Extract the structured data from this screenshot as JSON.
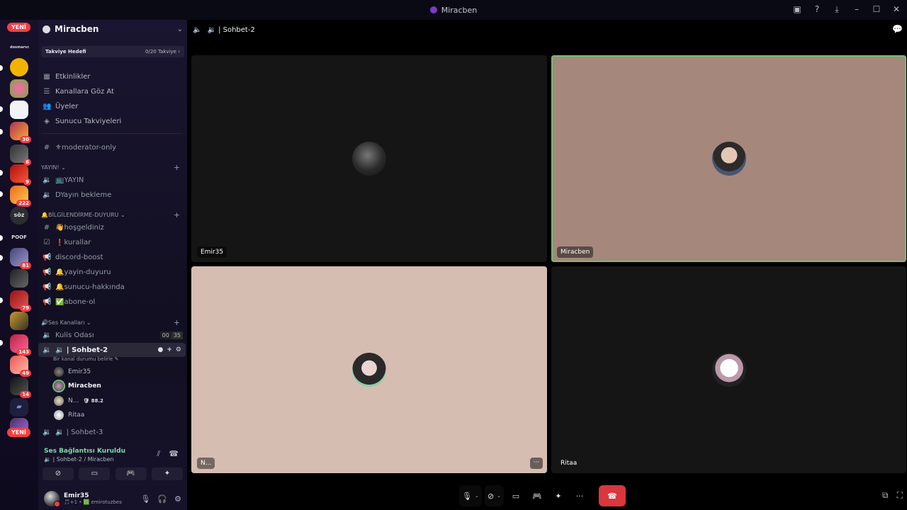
{
  "window": {
    "title": "Miracben"
  },
  "rail": {
    "new_label": "YENİ",
    "text_server_1": "dosmarvc",
    "text_server_2": "söz",
    "text_server_3": "POOF",
    "badges": [
      "30",
      "6",
      "9",
      "222",
      "81",
      "79",
      "143",
      "49",
      "14"
    ]
  },
  "guild": {
    "name": "Miracben",
    "boost_goal": "Takviye Hedefi",
    "boost_count": "0/20 Takviye"
  },
  "nav": [
    {
      "label": "Etkinlikler"
    },
    {
      "label": "Kanallara Göz At"
    },
    {
      "label": "Üyeler"
    },
    {
      "label": "Sunucu Takviyeleri"
    }
  ],
  "channels": {
    "moderator": "⚜moderator-only",
    "cat_yayin": "YAYIN! ⌄",
    "yayin": "📺YAYIN",
    "yayin_bekleme": "DYayın bekleme",
    "cat_bilgi": "🔔BİLGİLENDİRME-DUYURU ⌄",
    "hosgeldiniz": "👋hoşgeldiniz",
    "kurallar": "❗kurallar",
    "discord_boost": "discord-boost",
    "yayin_duyuru": "🔔yayin-duyuru",
    "sunucu_hakkinda": "🔔sunucu-hakkında",
    "abone_ol": "✅abone-ol",
    "cat_ses": "🔊Ses Kanalları ⌄",
    "kulis": "Kulis Odası",
    "kulis_count_a": "00",
    "kulis_count_b": "35",
    "sohbet2": "🔉 | Sohbet-2",
    "sohbet2_sub": "Bir kanal durumu belirle ✎",
    "sohbet3": "🔉 | Sohbet-3"
  },
  "voice_users": [
    {
      "name": "Emir35"
    },
    {
      "name": "Miracben"
    },
    {
      "name": "N...",
      "tag": "🛡 88.2"
    },
    {
      "name": "Ritaa"
    }
  ],
  "voice_panel": {
    "status": "Ses Bağlantısı Kuruldu",
    "channel": "🔉 | Sohbet-2 / Miracben"
  },
  "user": {
    "name": "Emir35",
    "sub": "🎵+1 • 🟩 emirotuzbes"
  },
  "main": {
    "header": "🔉 | Sohbet-2"
  },
  "tiles": [
    {
      "name": "Emir35"
    },
    {
      "name": "Miracben"
    },
    {
      "name": "N..."
    },
    {
      "name": "Ritaa"
    }
  ],
  "colors": {
    "accent": "#5865f2",
    "danger": "#da373c",
    "speaking": "#6fbf73",
    "tile_dark": "#151515",
    "tile_mauve": "#a5877c",
    "tile_pink": "#d6bdb1"
  }
}
